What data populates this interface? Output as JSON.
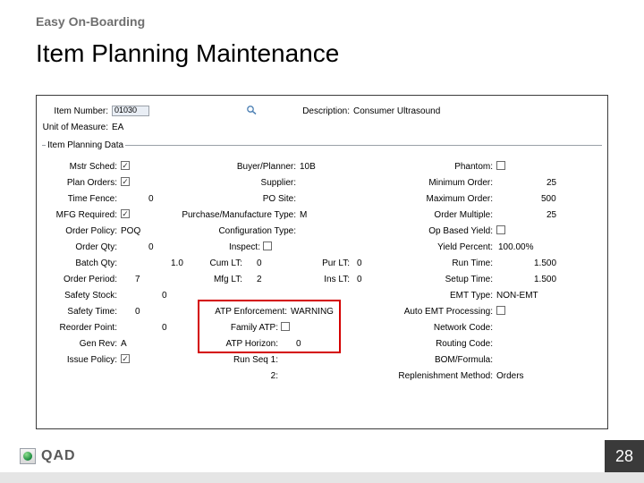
{
  "eyebrow": "Easy On-Boarding",
  "title": "Item Planning Maintenance",
  "header": {
    "item_number_label": "Item Number:",
    "item_number_value": "01030",
    "description_label": "Description:",
    "description_value": "Consumer Ultrasound",
    "uom_label": "Unit of Measure:",
    "uom_value": "EA"
  },
  "group_legend": "Item Planning Data",
  "col1": {
    "mstr_sched_label": "Mstr Sched:",
    "plan_orders_label": "Plan Orders:",
    "time_fence_label": "Time Fence:",
    "time_fence_value": "0",
    "mfg_required_label": "MFG Required:",
    "order_policy_label": "Order Policy:",
    "order_policy_value": "POQ",
    "order_qty_label": "Order Qty:",
    "order_qty_value": "0",
    "batch_qty_label": "Batch Qty:",
    "batch_qty_value": "1.0",
    "order_period_label": "Order Period:",
    "order_period_value": "7",
    "safety_stock_label": "Safety Stock:",
    "safety_stock_value": "0",
    "safety_time_label": "Safety Time:",
    "safety_time_value": "0",
    "reorder_point_label": "Reorder Point:",
    "reorder_point_value": "0",
    "gen_rev_label": "Gen Rev:",
    "gen_rev_value": "A",
    "issue_policy_label": "Issue Policy:"
  },
  "col2": {
    "buyer_planner_label": "Buyer/Planner:",
    "buyer_planner_value": "10B",
    "supplier_label": "Supplier:",
    "po_site_label": "PO Site:",
    "pm_type_label": "Purchase/Manufacture Type:",
    "pm_type_value": "M",
    "config_type_label": "Configuration Type:",
    "inspect_label": "Inspect:",
    "cum_lt_label": "Cum LT:",
    "cum_lt_value": "0",
    "mfg_lt_label": "Mfg LT:",
    "mfg_lt_value": "2",
    "atp_enf_label": "ATP Enforcement:",
    "atp_enf_value": "WARNING",
    "family_atp_label": "Family ATP:",
    "atp_horizon_label": "ATP Horizon:",
    "atp_horizon_value": "0",
    "run_seq1_label": "Run Seq 1:",
    "bottom_label": "2:"
  },
  "col3": {
    "phantom_label": "Phantom:",
    "min_order_label": "Minimum Order:",
    "min_order_value": "25",
    "max_order_label": "Maximum Order:",
    "max_order_value": "500",
    "order_mult_label": "Order Multiple:",
    "order_mult_value": "25",
    "op_based_yield_label": "Op Based Yield:",
    "yield_pct_label": "Yield Percent:",
    "yield_pct_value": "100.00%",
    "pur_lt_label": "Pur LT:",
    "pur_lt_value": "0",
    "ins_lt_label": "Ins LT:",
    "ins_lt_value": "0",
    "run_time_label": "Run Time:",
    "run_time_value": "1.500",
    "setup_time_label": "Setup Time:",
    "setup_time_value": "1.500",
    "emt_type_label": "EMT Type:",
    "emt_type_value": "NON-EMT",
    "auto_emt_label": "Auto EMT Processing:",
    "network_code_label": "Network Code:",
    "routing_code_label": "Routing Code:",
    "bom_formula_label": "BOM/Formula:",
    "replenish_label": "Replenishment Method:",
    "replenish_value": "Orders"
  },
  "icons": {
    "search": "search-icon"
  },
  "footer": {
    "brand": "QAD",
    "page": "28"
  }
}
